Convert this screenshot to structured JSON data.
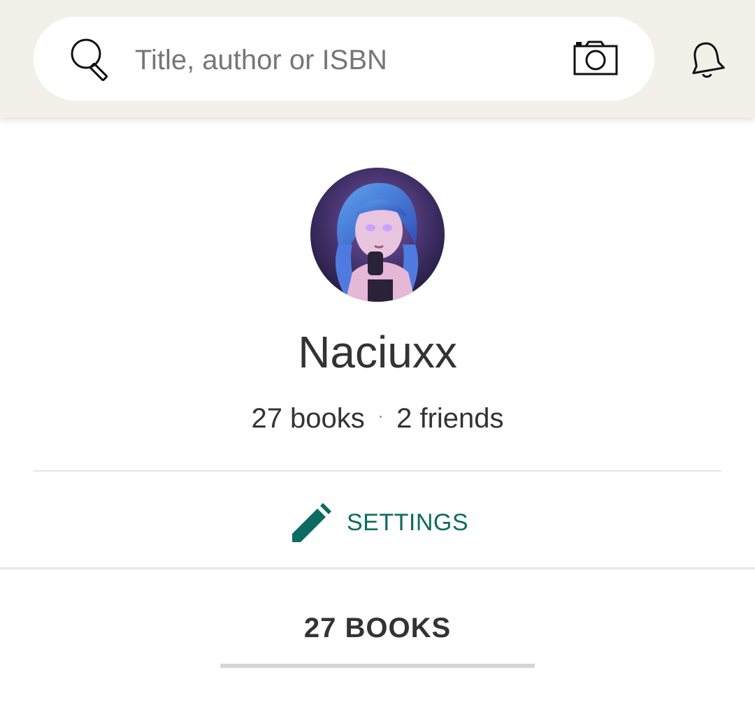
{
  "search": {
    "placeholder": "Title, author or ISBN"
  },
  "icons": {
    "search": "search-icon",
    "camera": "camera-icon",
    "notifications": "bell-icon",
    "edit": "pencil-icon"
  },
  "profile": {
    "username": "Naciuxx",
    "books_count_text": "27 books",
    "separator": "·",
    "friends_count_text": "2 friends"
  },
  "settings": {
    "label": "SETTINGS"
  },
  "books_tab": {
    "label": "27 BOOKS"
  },
  "colors": {
    "topbar_background": "#f3f0ea",
    "accent": "#0d6b61",
    "text_primary": "#333333",
    "placeholder_text": "#767676"
  }
}
